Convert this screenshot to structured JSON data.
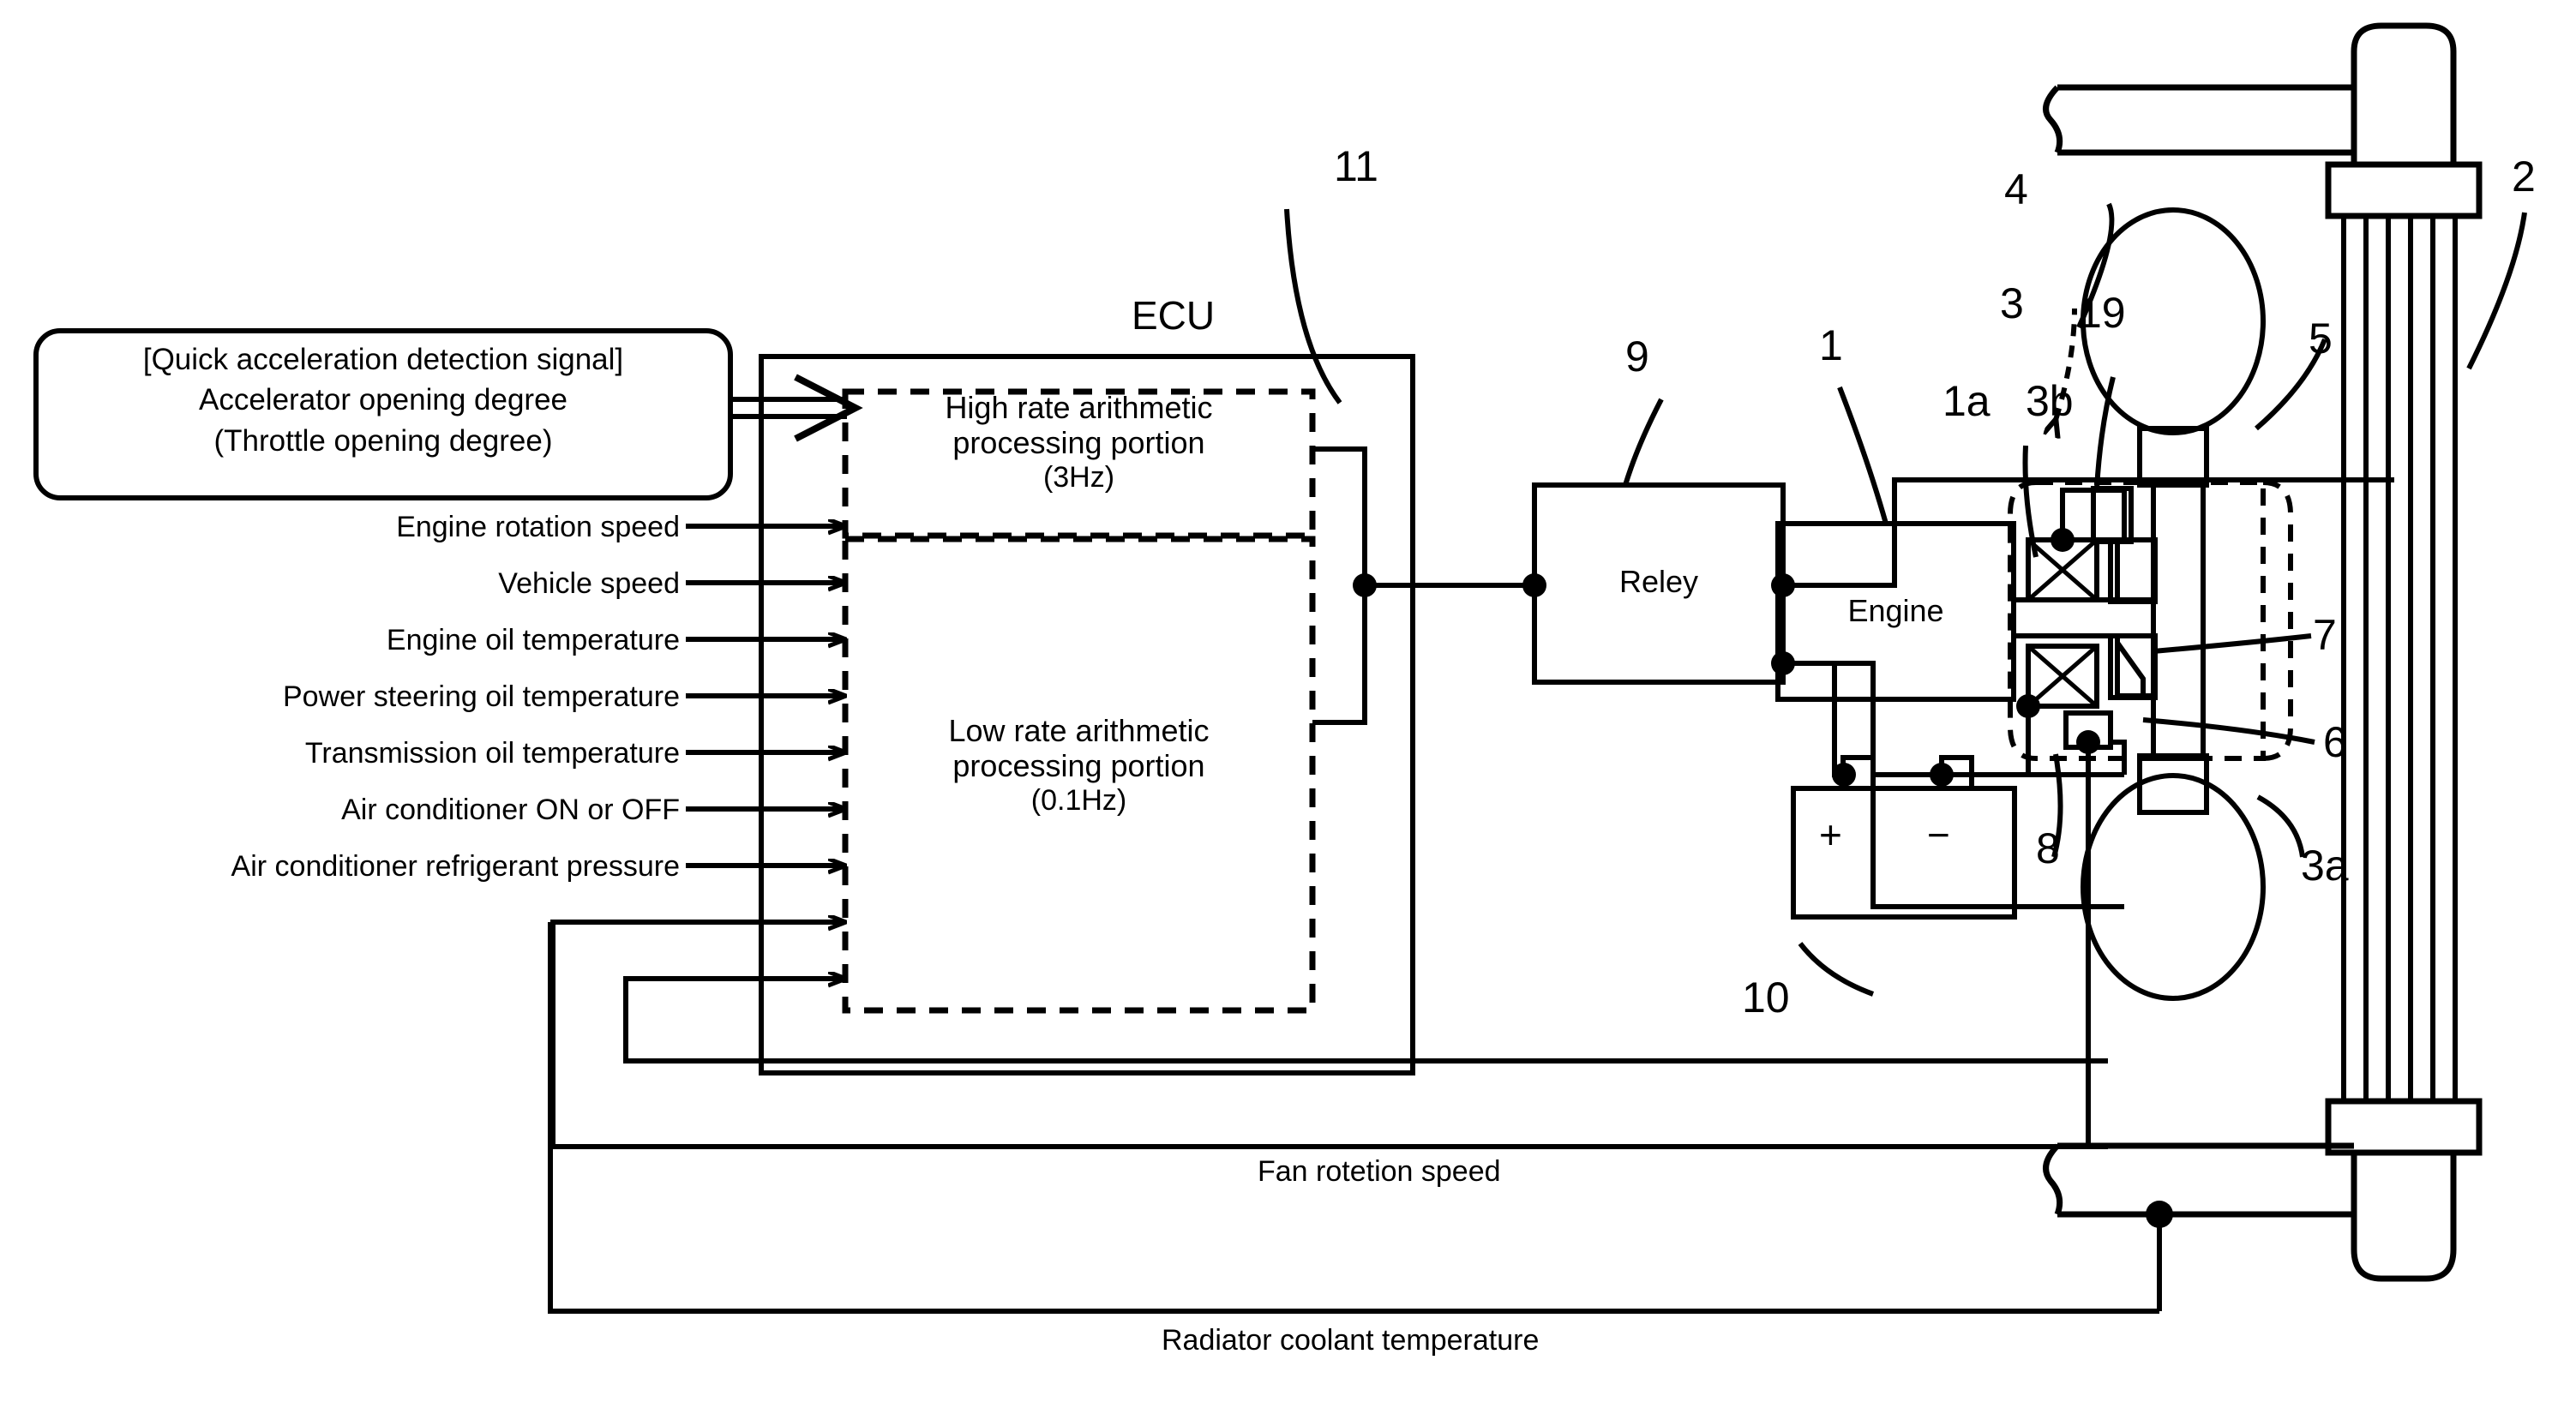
{
  "figure": {
    "type": "patent-diagram",
    "title": "Engine cooling fan control system block diagram"
  },
  "callout": {
    "line1": "[Quick acceleration detection signal]",
    "line2": "Accelerator opening degree",
    "line3": "(Throttle opening degree)"
  },
  "input_signals": [
    {
      "label": "Engine rotation speed"
    },
    {
      "label": "Vehicle speed"
    },
    {
      "label": "Engine oil temperature"
    },
    {
      "label": "Power steering oil temperature"
    },
    {
      "label": "Transmission oil temperature"
    },
    {
      "label": "Air conditioner ON or OFF"
    },
    {
      "label": "Air conditioner refrigerant pressure"
    }
  ],
  "feedback_signals": [
    {
      "label": "Fan rotetion speed"
    },
    {
      "label": "Radiator coolant temperature"
    }
  ],
  "ecu": {
    "title": "ECU",
    "high_rate": {
      "line1": "High rate arithmetic",
      "line2": "processing portion",
      "line3": "(3Hz)"
    },
    "low_rate": {
      "line1": "Low rate arithmetic",
      "line2": "processing portion",
      "line3": "(0.1Hz)"
    }
  },
  "blocks": {
    "relay": "Reley",
    "engine": "Engine"
  },
  "battery": {
    "plus": "+",
    "minus": "−"
  },
  "reference_numerals": [
    {
      "id": "11",
      "text": "11"
    },
    {
      "id": "9",
      "text": "9"
    },
    {
      "id": "1",
      "text": "1"
    },
    {
      "id": "1a",
      "text": "1a"
    },
    {
      "id": "3b",
      "text": "3b"
    },
    {
      "id": "3",
      "text": "3"
    },
    {
      "id": "19",
      "text": "19"
    },
    {
      "id": "4",
      "text": "4"
    },
    {
      "id": "5",
      "text": "5"
    },
    {
      "id": "2",
      "text": "2"
    },
    {
      "id": "7",
      "text": "7"
    },
    {
      "id": "6",
      "text": "6"
    },
    {
      "id": "3a",
      "text": "3a"
    },
    {
      "id": "8",
      "text": "8"
    },
    {
      "id": "10",
      "text": "10"
    }
  ],
  "colors": {
    "line": "#000000",
    "background": "#ffffff"
  }
}
